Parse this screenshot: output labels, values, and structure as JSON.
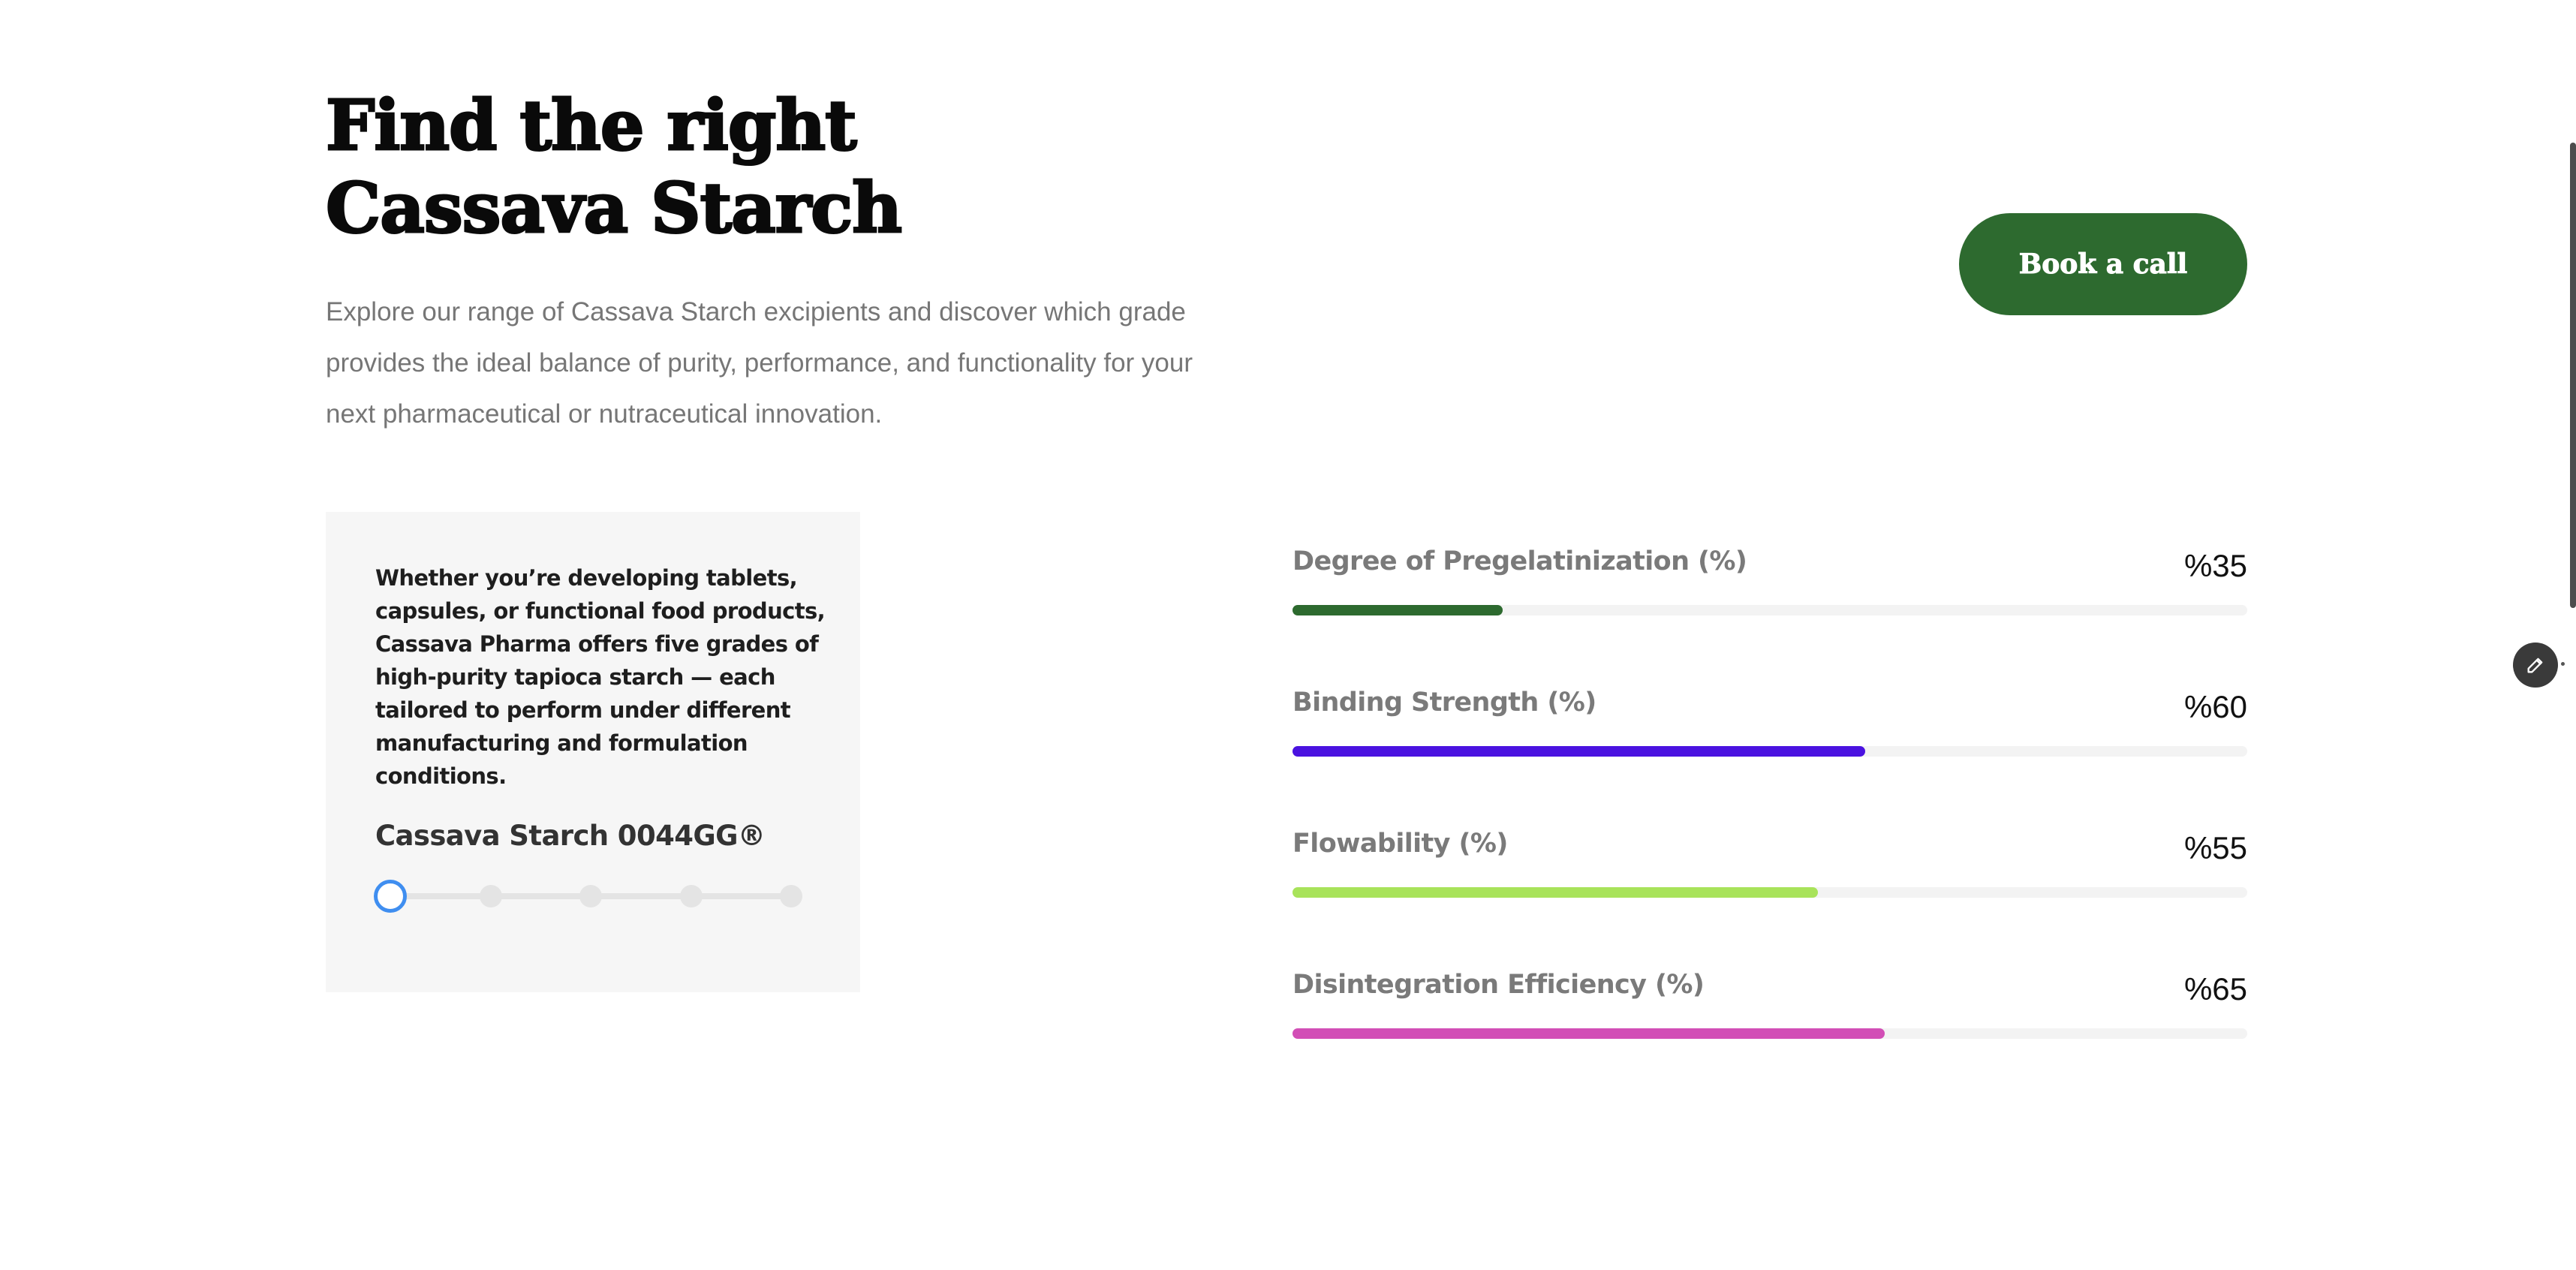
{
  "hero": {
    "title_line1": "Find the right",
    "title_line2": "Cassava Starch",
    "intro": "Explore our range of Cassava Starch excipients and discover which grade provides the ideal balance of purity, performance, and functionality for your next pharmaceutical or nutraceutical innovation.",
    "cta_label": "Book a call"
  },
  "card": {
    "description": "Whether you’re developing tablets, capsules, or functional food products, Cassava Pharma offers five grades of high-purity tapioca starch — each tailored to perform under different manufacturing and formulation conditions.",
    "grade_name": "Cassava Starch 0044GG®",
    "slider": {
      "steps": 5,
      "selected_index": 0
    }
  },
  "metrics": [
    {
      "label": "Degree of Pregelatinization (%)",
      "value_text": "%35",
      "value": 22,
      "color": "#2d6a2f"
    },
    {
      "label": "Binding Strength (%)",
      "value_text": "%60",
      "value": 60,
      "color": "#4a12e0"
    },
    {
      "label": "Flowability (%)",
      "value_text": "%55",
      "value": 55,
      "color": "#a8e35a"
    },
    {
      "label": "Disintegration Efficiency (%)",
      "value_text": "%65",
      "value": 62,
      "color": "#d24eb6"
    }
  ],
  "colors": {
    "brand_green": "#2d6a2f",
    "slider_active": "#3f8ef0"
  },
  "icons": {
    "edit": "pencil-icon"
  }
}
